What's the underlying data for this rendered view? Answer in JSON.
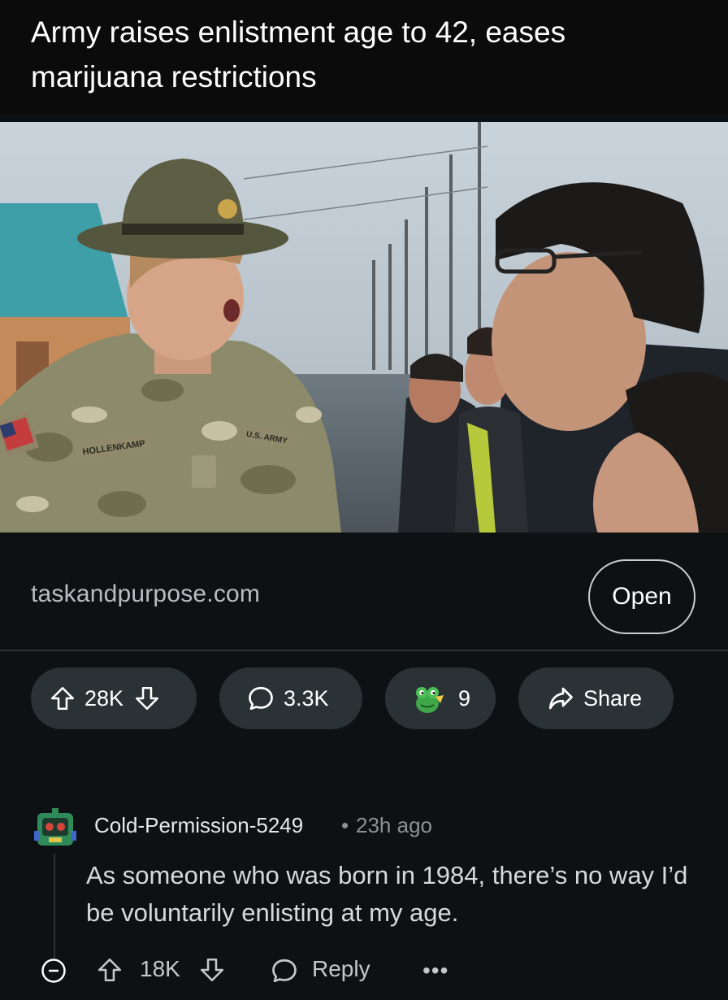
{
  "post": {
    "title": "Army raises enlistment age to 42, eases marijuana restrictions",
    "domain": "taskandpurpose.com",
    "open_label": "Open",
    "upvotes": "28K",
    "comments": "3.3K",
    "awards": "9",
    "share_label": "Share",
    "image_text": {
      "name_tape": "HOLLENKAMP",
      "branch_tape": "U.S. ARMY"
    }
  },
  "comment": {
    "author": "Cold-Permission-5249",
    "separator": "•",
    "time": "23h ago",
    "body": "As someone who was born in 1984, there’s no way I’d be voluntarily enlisting at my age.",
    "votes": "18K",
    "reply_label": "Reply",
    "more_label": "•••"
  },
  "colors": {
    "background": "#0e1113",
    "pill": "#2a3236",
    "text": "#f2f4f5",
    "muted": "#8b9296"
  },
  "icons": [
    "upvote-icon",
    "downvote-icon",
    "comment-icon",
    "award-icon",
    "share-icon",
    "collapse-icon",
    "reply-icon",
    "avatar-icon"
  ]
}
